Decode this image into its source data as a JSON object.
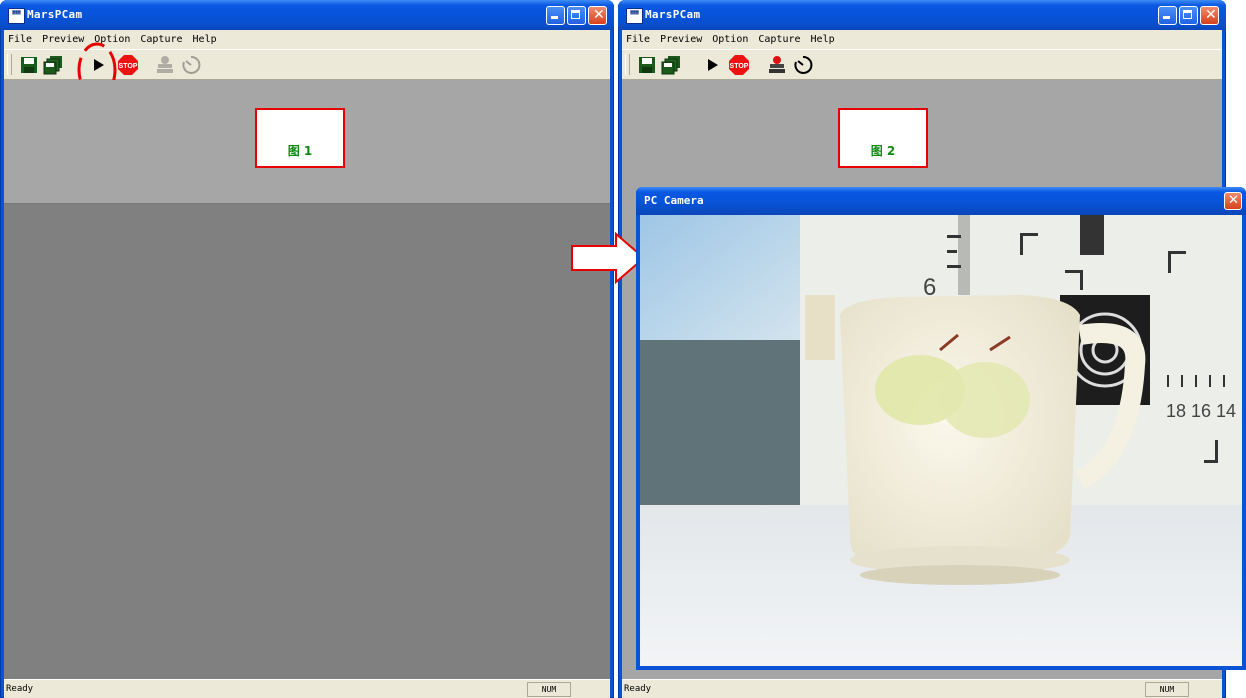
{
  "windows": [
    {
      "title": "MarsPCam",
      "icon_text": "MarsPCam",
      "menu": [
        "File",
        "Preview",
        "Option",
        "Capture",
        "Help"
      ],
      "figure_label": "图 1",
      "status": "Ready",
      "num_indicator": "NUM"
    },
    {
      "title": "MarsPCam",
      "icon_text": "MarsPCam",
      "menu": [
        "File",
        "Preview",
        "Option",
        "Capture",
        "Help"
      ],
      "figure_label": "图 2",
      "status": "Ready",
      "num_indicator": "NUM"
    }
  ],
  "toolbar_icons": [
    "save-icon",
    "save-all-icon",
    "play-icon",
    "stop-icon",
    "snapshot-icon",
    "timer-icon"
  ],
  "camera_window": {
    "title": "PC Camera",
    "scene_labels": [
      "6",
      "18 16 14"
    ]
  },
  "colors": {
    "title_blue": "#0a53d6",
    "close_red": "#d6421d",
    "highlight_red": "#e60000",
    "label_green": "#118a11",
    "client_gray": "#808080",
    "preview_gray": "#a6a6a6"
  }
}
